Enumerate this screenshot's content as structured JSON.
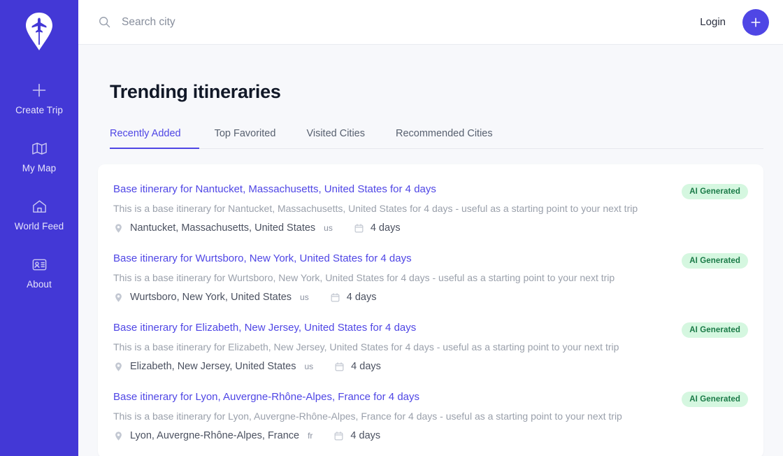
{
  "colors": {
    "sidebar_bg": "#4338d6",
    "accent": "#4f46e5",
    "badge_bg": "#d5f7e0",
    "badge_text": "#1a7a47",
    "page_bg": "#f7f8fb"
  },
  "sidebar": {
    "logo_icon": "map-pin-airplane-logo",
    "items": [
      {
        "label": "Create Trip",
        "icon": "plus-icon"
      },
      {
        "label": "My Map",
        "icon": "map-icon"
      },
      {
        "label": "World Feed",
        "icon": "home-icon"
      },
      {
        "label": "About",
        "icon": "id-card-icon"
      }
    ]
  },
  "topbar": {
    "search_icon": "search-icon",
    "search_value": "",
    "search_placeholder": "Search city",
    "login_label": "Login",
    "add_icon": "plus-icon"
  },
  "main": {
    "title": "Trending itineraries",
    "tabs": [
      {
        "label": "Recently Added",
        "active": true
      },
      {
        "label": "Top Favorited",
        "active": false
      },
      {
        "label": "Visited Cities",
        "active": false
      },
      {
        "label": "Recommended Cities",
        "active": false
      }
    ],
    "itineraries": [
      {
        "title": "Base itinerary for Nantucket, Massachusetts, United States for 4 days",
        "description": "This is a base itinerary for Nantucket, Massachusetts, United States for 4 days - useful as a starting point to your next trip",
        "location": "Nantucket, Massachusetts, United States",
        "country_code": "us",
        "duration": "4 days",
        "badge": "AI Generated"
      },
      {
        "title": "Base itinerary for Wurtsboro, New York, United States for 4 days",
        "description": "This is a base itinerary for Wurtsboro, New York, United States for 4 days - useful as a starting point to your next trip",
        "location": "Wurtsboro, New York, United States",
        "country_code": "us",
        "duration": "4 days",
        "badge": "AI Generated"
      },
      {
        "title": "Base itinerary for Elizabeth, New Jersey, United States for 4 days",
        "description": "This is a base itinerary for Elizabeth, New Jersey, United States for 4 days - useful as a starting point to your next trip",
        "location": "Elizabeth, New Jersey, United States",
        "country_code": "us",
        "duration": "4 days",
        "badge": "AI Generated"
      },
      {
        "title": "Base itinerary for Lyon, Auvergne-Rhône-Alpes, France for 4 days",
        "description": "This is a base itinerary for Lyon, Auvergne-Rhône-Alpes, France for 4 days - useful as a starting point to your next trip",
        "location": "Lyon, Auvergne-Rhône-Alpes, France",
        "country_code": "fr",
        "duration": "4 days",
        "badge": "AI Generated"
      }
    ]
  }
}
